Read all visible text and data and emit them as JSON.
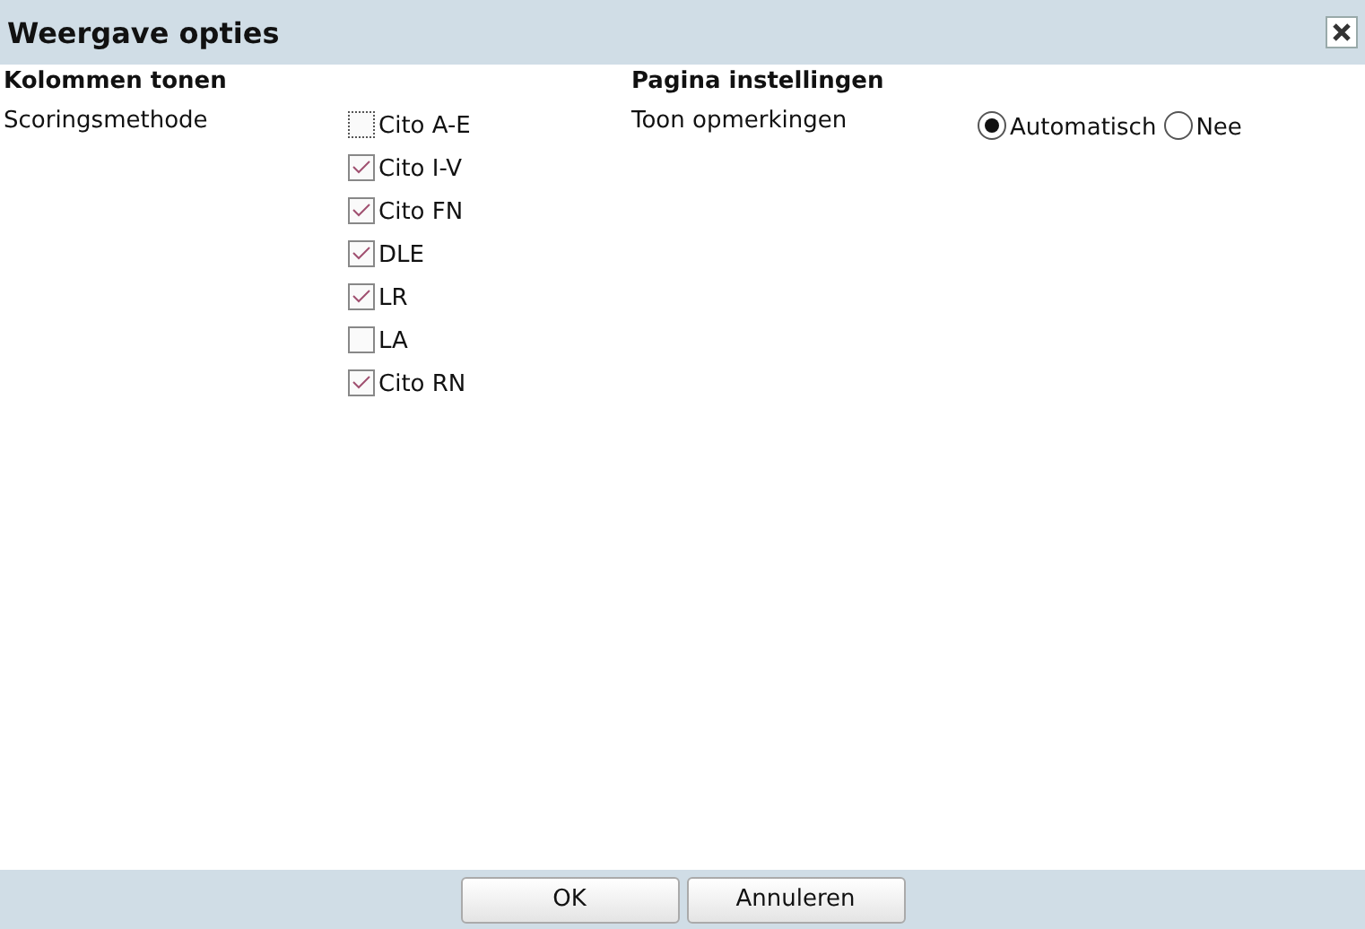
{
  "window": {
    "title": "Weergave opties"
  },
  "columns_section": {
    "heading": "Kolommen tonen",
    "label": "Scoringsmethode",
    "options": [
      {
        "label": "Cito A-E",
        "checked": false,
        "focused": true
      },
      {
        "label": "Cito I-V",
        "checked": true,
        "focused": false
      },
      {
        "label": "Cito FN",
        "checked": true,
        "focused": false
      },
      {
        "label": "DLE",
        "checked": true,
        "focused": false
      },
      {
        "label": "LR",
        "checked": true,
        "focused": false
      },
      {
        "label": "LA",
        "checked": false,
        "focused": false
      },
      {
        "label": "Cito RN",
        "checked": true,
        "focused": false
      }
    ]
  },
  "page_section": {
    "heading": "Pagina instellingen",
    "label": "Toon opmerkingen",
    "options": [
      {
        "label": "Automatisch",
        "selected": true
      },
      {
        "label": "Nee",
        "selected": false
      }
    ]
  },
  "buttons": [
    "OK",
    "Annuleren"
  ]
}
